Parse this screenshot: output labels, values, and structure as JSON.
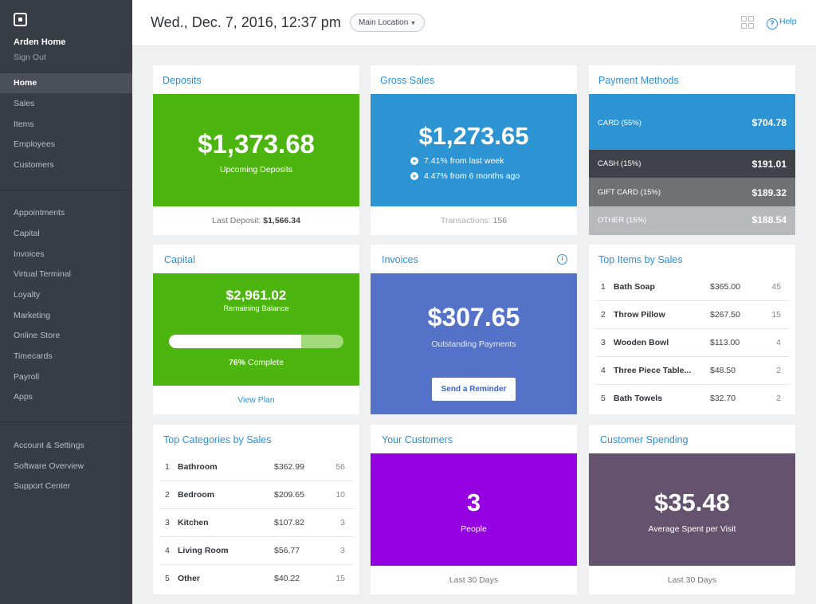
{
  "sidebar": {
    "merchant_name": "Arden Home",
    "sign_out": "Sign Out",
    "nav_primary": [
      {
        "label": "Home",
        "active": true
      },
      {
        "label": "Sales"
      },
      {
        "label": "Items"
      },
      {
        "label": "Employees"
      },
      {
        "label": "Customers"
      }
    ],
    "nav_secondary": [
      {
        "label": "Appointments"
      },
      {
        "label": "Capital"
      },
      {
        "label": "Invoices"
      },
      {
        "label": "Virtual Terminal"
      },
      {
        "label": "Loyalty"
      },
      {
        "label": "Marketing"
      },
      {
        "label": "Online Store"
      },
      {
        "label": "Timecards"
      },
      {
        "label": "Payroll"
      },
      {
        "label": "Apps"
      }
    ],
    "nav_tertiary": [
      {
        "label": "Account & Settings"
      },
      {
        "label": "Software Overview"
      },
      {
        "label": "Support Center"
      }
    ]
  },
  "header": {
    "datetime": "Wed., Dec. 7, 2016, 12:37 pm",
    "location": "Main Location",
    "help": "Help"
  },
  "deposits": {
    "title": "Deposits",
    "amount": "$1,373.68",
    "caption": "Upcoming Deposits",
    "footer_label": "Last Deposit:",
    "footer_value": "$1,566.34",
    "color": "#4cb50f"
  },
  "gross_sales": {
    "title": "Gross Sales",
    "amount": "$1,273.65",
    "change_week": "7.41% from last week",
    "change_months": "4.47% from 6 months ago",
    "footer_label": "Transactions:",
    "footer_value": "156",
    "color": "#2c94d3"
  },
  "payment_methods": {
    "title": "Payment Methods",
    "rows": [
      {
        "label": "CARD",
        "pct": "(55%)",
        "value": "$704.78",
        "color": "#2c94d3"
      },
      {
        "label": "CASH",
        "pct": "(15%)",
        "value": "$191.01",
        "color": "#3e434a"
      },
      {
        "label": "GIFT CARD",
        "pct": "(15%)",
        "value": "$189.32",
        "color": "#6d7277"
      },
      {
        "label": "OTHER",
        "pct": "(15%)",
        "value": "$188.54",
        "color": "#b6babf"
      }
    ]
  },
  "capital": {
    "title": "Capital",
    "amount": "$2,961.02",
    "caption": "Remaining Balance",
    "progress": 0.76,
    "percent_label": "76%",
    "complete_label": "Complete",
    "link": "View Plan",
    "color": "#4cb50f"
  },
  "invoices": {
    "title": "Invoices",
    "info_icon": "info-icon",
    "amount": "$307.65",
    "caption": "Outstanding Payments",
    "button": "Send a Reminder",
    "color": "#5372c8"
  },
  "top_items": {
    "title": "Top Items by Sales",
    "rows": [
      {
        "rank": "1",
        "name": "Bath Soap",
        "amount": "$365.00",
        "count": "45"
      },
      {
        "rank": "2",
        "name": "Throw Pillow",
        "amount": "$267.50",
        "count": "15"
      },
      {
        "rank": "3",
        "name": "Wooden Bowl",
        "amount": "$113.00",
        "count": "4"
      },
      {
        "rank": "4",
        "name": "Three Piece Table...",
        "amount": "$48.50",
        "count": "2"
      },
      {
        "rank": "5",
        "name": "Bath Towels",
        "amount": "$32.70",
        "count": "2"
      }
    ]
  },
  "top_categories": {
    "title": "Top Categories by Sales",
    "rows": [
      {
        "rank": "1",
        "name": "Bathroom",
        "amount": "$362.99",
        "count": "56"
      },
      {
        "rank": "2",
        "name": "Bedroom",
        "amount": "$209.65",
        "count": "10"
      },
      {
        "rank": "3",
        "name": "Kitchen",
        "amount": "$107.82",
        "count": "3"
      },
      {
        "rank": "4",
        "name": "Living Room",
        "amount": "$56.77",
        "count": "3"
      },
      {
        "rank": "5",
        "name": "Other",
        "amount": "$40.22",
        "count": "15"
      }
    ]
  },
  "your_customers": {
    "title": "Your Customers",
    "amount": "3",
    "caption": "People",
    "footer": "Last 30 Days",
    "color": "#9400e0"
  },
  "customer_spending": {
    "title": "Customer Spending",
    "amount": "$35.48",
    "caption": "Average Spent per Visit",
    "footer": "Last 30 Days",
    "color": "#64526e"
  }
}
